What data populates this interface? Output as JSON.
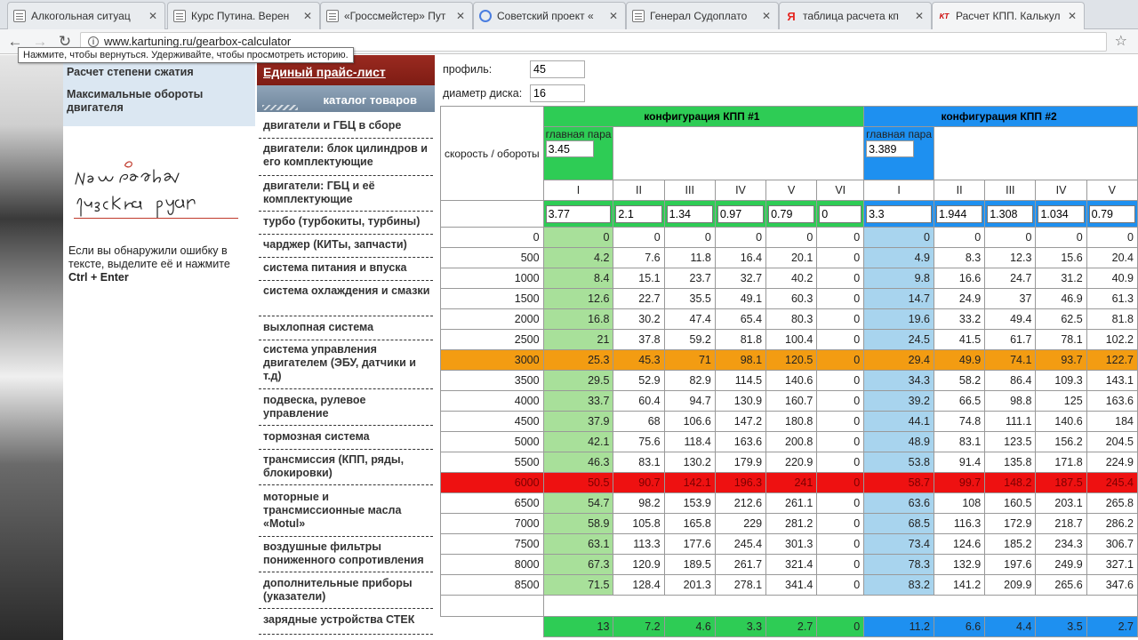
{
  "browser": {
    "tabs": [
      {
        "title": "Алкогольная ситуац",
        "icon": "doc-icon"
      },
      {
        "title": "Курс Путина. Верен",
        "icon": "doc-icon"
      },
      {
        "title": "«Гроссмейстер» Пут",
        "icon": "doc-icon"
      },
      {
        "title": "Советский проект «",
        "icon": "globe-icon"
      },
      {
        "title": "Генерал Судоплато",
        "icon": "doc-icon"
      },
      {
        "title": "таблица расчета кп",
        "icon": "yandex-icon"
      },
      {
        "title": "Расчет КПП. Калькул",
        "icon": "kt-icon"
      }
    ],
    "url": "www.kartuning.ru/gearbox-calculator",
    "back_tooltip": "Нажмите, чтобы вернуться. Удерживайте, чтобы просмотреть историю."
  },
  "left_menu": {
    "items": [
      "Расчет степени сжатия",
      "Максимальные обороты двигателя"
    ],
    "handwriting": "Наш родной русский язык",
    "error_note_text": "Если вы обнаружили ошибку в тексте, выделите её и нажмите",
    "error_note_keys": "Ctrl + Enter"
  },
  "catalog": {
    "price_list": "Единый прайс-лист",
    "header": "каталог товаров",
    "items": [
      "двигатели и ГБЦ в сборе",
      "двигатели: блок цилиндров и его комплектующие",
      "двигатели: ГБЦ и её комплектующие",
      "турбо (турбокиты, турбины)",
      "чарджер (КИТы, запчасти)",
      "система питания и впуска",
      "система охлаждения и смазки",
      "выхлопная система",
      "система управления двигателем (ЭБУ, датчики и т.д)",
      "подвеска, рулевое управление",
      "тормозная система",
      "трансмиссия (КПП, ряды, блокировки)",
      "моторные и трансмиссионные масла «Motul»",
      "воздушные фильтры пониженного сопротивления",
      "дополнительные приборы (указатели)",
      "зарядные устройства СТЕК"
    ]
  },
  "calculator": {
    "profile_label": "профиль:",
    "profile_value": "45",
    "disk_label": "диаметр диска:",
    "disk_value": "16",
    "speed_label": "скорость / обороты",
    "main_pair_label": "главная пара",
    "config1": {
      "title": "конфигурация КПП #1",
      "main_pair": "3.45",
      "gears": [
        "I",
        "II",
        "III",
        "IV",
        "V",
        "VI"
      ],
      "ratios": [
        "3.77",
        "2.1",
        "1.34",
        "0.97",
        "0.79",
        "0"
      ]
    },
    "config2": {
      "title": "конфигурация КПП #2",
      "main_pair": "3.389",
      "gears": [
        "I",
        "II",
        "III",
        "IV",
        "V"
      ],
      "ratios": [
        "3.3",
        "1.944",
        "1.308",
        "1.034",
        "0.79"
      ]
    },
    "rows": [
      {
        "rpm": "0",
        "c1": [
          "0",
          "0",
          "0",
          "0",
          "0",
          "0"
        ],
        "c2": [
          "0",
          "0",
          "0",
          "0",
          "0"
        ]
      },
      {
        "rpm": "500",
        "c1": [
          "4.2",
          "7.6",
          "11.8",
          "16.4",
          "20.1",
          "0"
        ],
        "c2": [
          "4.9",
          "8.3",
          "12.3",
          "15.6",
          "20.4"
        ]
      },
      {
        "rpm": "1000",
        "c1": [
          "8.4",
          "15.1",
          "23.7",
          "32.7",
          "40.2",
          "0"
        ],
        "c2": [
          "9.8",
          "16.6",
          "24.7",
          "31.2",
          "40.9"
        ]
      },
      {
        "rpm": "1500",
        "c1": [
          "12.6",
          "22.7",
          "35.5",
          "49.1",
          "60.3",
          "0"
        ],
        "c2": [
          "14.7",
          "24.9",
          "37",
          "46.9",
          "61.3"
        ]
      },
      {
        "rpm": "2000",
        "c1": [
          "16.8",
          "30.2",
          "47.4",
          "65.4",
          "80.3",
          "0"
        ],
        "c2": [
          "19.6",
          "33.2",
          "49.4",
          "62.5",
          "81.8"
        ]
      },
      {
        "rpm": "2500",
        "c1": [
          "21",
          "37.8",
          "59.2",
          "81.8",
          "100.4",
          "0"
        ],
        "c2": [
          "24.5",
          "41.5",
          "61.7",
          "78.1",
          "102.2"
        ]
      },
      {
        "rpm": "3000",
        "c1": [
          "25.3",
          "45.3",
          "71",
          "98.1",
          "120.5",
          "0"
        ],
        "c2": [
          "29.4",
          "49.9",
          "74.1",
          "93.7",
          "122.7"
        ],
        "highlight": "orange"
      },
      {
        "rpm": "3500",
        "c1": [
          "29.5",
          "52.9",
          "82.9",
          "114.5",
          "140.6",
          "0"
        ],
        "c2": [
          "34.3",
          "58.2",
          "86.4",
          "109.3",
          "143.1"
        ]
      },
      {
        "rpm": "4000",
        "c1": [
          "33.7",
          "60.4",
          "94.7",
          "130.9",
          "160.7",
          "0"
        ],
        "c2": [
          "39.2",
          "66.5",
          "98.8",
          "125",
          "163.6"
        ]
      },
      {
        "rpm": "4500",
        "c1": [
          "37.9",
          "68",
          "106.6",
          "147.2",
          "180.8",
          "0"
        ],
        "c2": [
          "44.1",
          "74.8",
          "111.1",
          "140.6",
          "184"
        ]
      },
      {
        "rpm": "5000",
        "c1": [
          "42.1",
          "75.6",
          "118.4",
          "163.6",
          "200.8",
          "0"
        ],
        "c2": [
          "48.9",
          "83.1",
          "123.5",
          "156.2",
          "204.5"
        ]
      },
      {
        "rpm": "5500",
        "c1": [
          "46.3",
          "83.1",
          "130.2",
          "179.9",
          "220.9",
          "0"
        ],
        "c2": [
          "53.8",
          "91.4",
          "135.8",
          "171.8",
          "224.9"
        ]
      },
      {
        "rpm": "6000",
        "c1": [
          "50.5",
          "90.7",
          "142.1",
          "196.3",
          "241",
          "0"
        ],
        "c2": [
          "58.7",
          "99.7",
          "148.2",
          "187.5",
          "245.4"
        ],
        "highlight": "red"
      },
      {
        "rpm": "6500",
        "c1": [
          "54.7",
          "98.2",
          "153.9",
          "212.6",
          "261.1",
          "0"
        ],
        "c2": [
          "63.6",
          "108",
          "160.5",
          "203.1",
          "265.8"
        ]
      },
      {
        "rpm": "7000",
        "c1": [
          "58.9",
          "105.8",
          "165.8",
          "229",
          "281.2",
          "0"
        ],
        "c2": [
          "68.5",
          "116.3",
          "172.9",
          "218.7",
          "286.2"
        ]
      },
      {
        "rpm": "7500",
        "c1": [
          "63.1",
          "113.3",
          "177.6",
          "245.4",
          "301.3",
          "0"
        ],
        "c2": [
          "73.4",
          "124.6",
          "185.2",
          "234.3",
          "306.7"
        ]
      },
      {
        "rpm": "8000",
        "c1": [
          "67.3",
          "120.9",
          "189.5",
          "261.7",
          "321.4",
          "0"
        ],
        "c2": [
          "78.3",
          "132.9",
          "197.6",
          "249.9",
          "327.1"
        ]
      },
      {
        "rpm": "8500",
        "c1": [
          "71.5",
          "128.4",
          "201.3",
          "278.1",
          "341.4",
          "0"
        ],
        "c2": [
          "83.2",
          "141.2",
          "209.9",
          "265.6",
          "347.6"
        ]
      }
    ],
    "summary": {
      "c1": [
        "13",
        "7.2",
        "4.6",
        "3.3",
        "2.7",
        "0"
      ],
      "c2": [
        "11.2",
        "6.6",
        "4.4",
        "3.5",
        "2.7"
      ]
    }
  }
}
